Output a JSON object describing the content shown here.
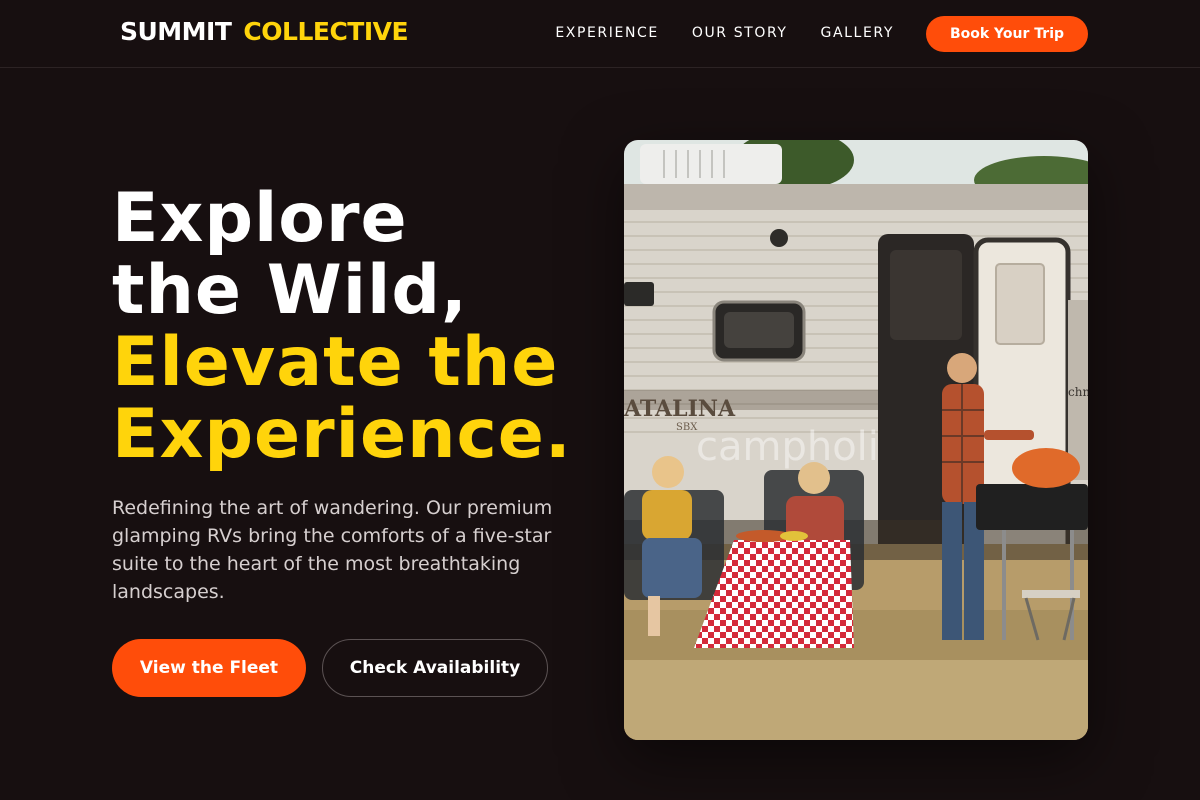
{
  "nav": {
    "logo": {
      "word1": "SUMMIT",
      "word2": "COLLECTIVE"
    },
    "links": [
      {
        "label": "EXPERIENCE"
      },
      {
        "label": "OUR STORY"
      },
      {
        "label": "GALLERY"
      }
    ],
    "cta_label": "Book Your Trip"
  },
  "hero": {
    "title_lines": [
      "Explore",
      "the Wild,",
      "Elevate the",
      "Experience."
    ],
    "description": "Redefining the art of wandering. Our premium glamping RVs bring the comforts of a five-star suite to the heart of the most breathtaking landscapes.",
    "primary_button": "View the Fleet",
    "secondary_button": "Check Availability",
    "image": {
      "rv_brand": "ATALINA",
      "rv_sub": "SBX",
      "watermark": "campholi",
      "door_text": "chm"
    }
  },
  "colors": {
    "background": "#170f10",
    "accent_orange": "#ff4d0a",
    "accent_yellow": "#ffd40b",
    "text_muted": "#d6cfcf"
  }
}
